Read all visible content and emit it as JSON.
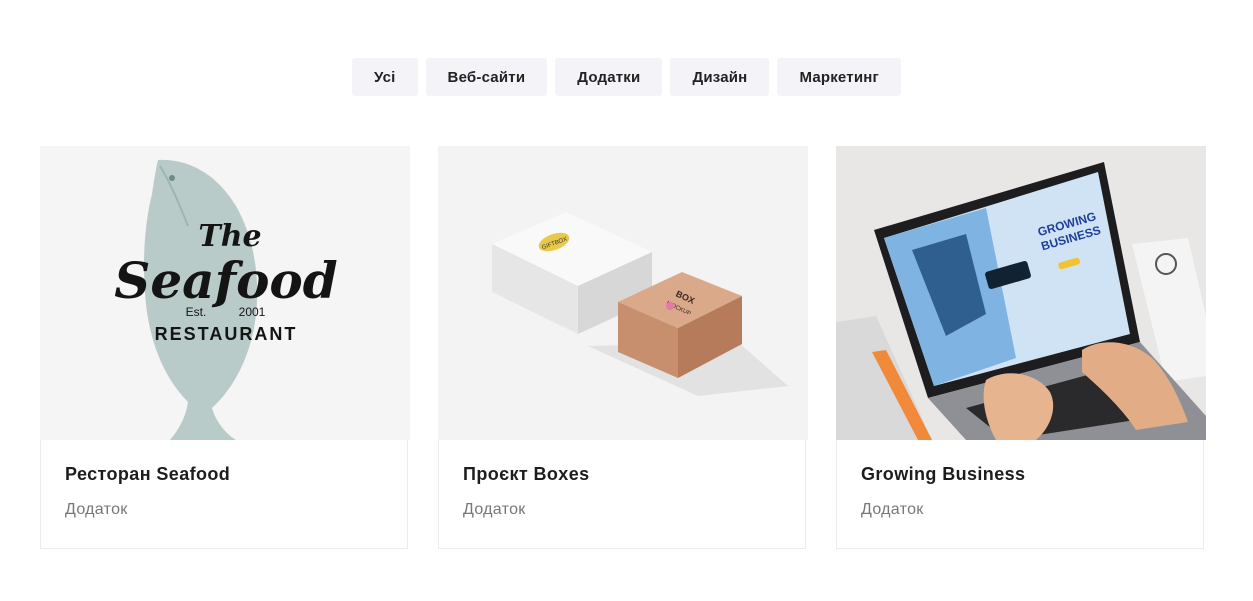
{
  "filters": [
    {
      "label": "Усі"
    },
    {
      "label": "Веб-сайти"
    },
    {
      "label": "Додатки"
    },
    {
      "label": "Дизайн"
    },
    {
      "label": "Маркетинг"
    }
  ],
  "projects": [
    {
      "title": "Ресторан Seafood",
      "category": "Додаток",
      "logo": {
        "line1": "The",
        "line2": "Seafood",
        "est": "Est.",
        "year": "2001",
        "line3": "RESTAURANT"
      }
    },
    {
      "title": "Проєкт Boxes",
      "category": "Додаток",
      "mockup": {
        "box1_label": "GIFTBOX",
        "box2_label": "BOX",
        "box2_sub": "MOCKUP"
      }
    },
    {
      "title": "Growing Business",
      "category": "Додаток",
      "screen": {
        "headline1": "GROWING",
        "headline2": "BUSINESS"
      }
    }
  ],
  "colors": {
    "filter_bg": "#f4f4f8",
    "card_border": "#ececec",
    "title": "#1d1d1d",
    "category": "#777777"
  }
}
